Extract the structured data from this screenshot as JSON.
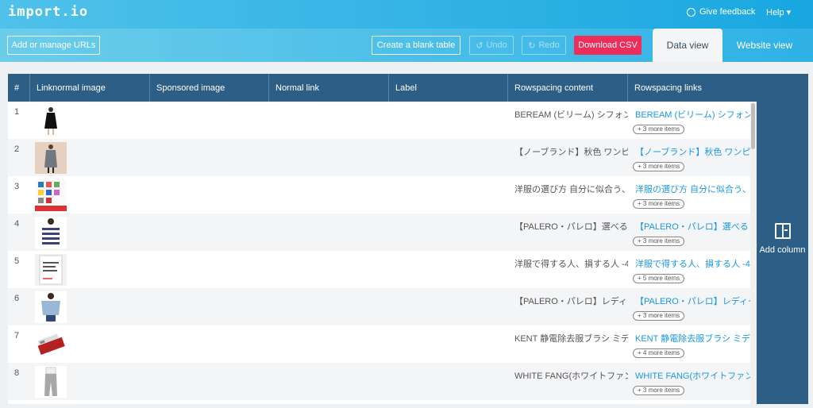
{
  "app": {
    "logo": "import.io",
    "feedback": "Give feedback",
    "help": "Help ▾"
  },
  "toolbar": {
    "add_urls": "Add or manage URLs",
    "blank_table": "Create a blank table",
    "undo": "Undo",
    "redo": "Redo",
    "download": "Download CSV",
    "tab_data": "Data view",
    "tab_website": "Website view"
  },
  "columns": [
    "#",
    "Linknormal image",
    "Sponsored image",
    "Normal link",
    "Label",
    "Rowspacing content",
    "Rowspacing links"
  ],
  "rows": [
    {
      "num": "1",
      "thumb": "dress-black",
      "content": "BEREAM (ビリーム) シフォン...",
      "link": "BEREAM (ビリーム) シフォン...",
      "more": "+ 3 more items"
    },
    {
      "num": "2",
      "thumb": "dress-grey",
      "content": "【ノーブランド】秋色 ワンピ...",
      "link": "【ノーブランド】秋色 ワンピ...",
      "more": "+ 3 more items"
    },
    {
      "num": "3",
      "thumb": "book-clothes",
      "content": "洋服の選び方 自分に似合う、...",
      "link": "洋服の選び方 自分に似合う、...",
      "more": "+ 3 more items"
    },
    {
      "num": "4",
      "thumb": "striped-top",
      "content": "【PALERO・パレロ】選べる６...",
      "link": "【PALERO・パレロ】選べる６...",
      "more": "+ 3 more items"
    },
    {
      "num": "5",
      "thumb": "book-white",
      "content": "洋服で得する人、損する人 -4...",
      "link": "洋服で得する人、損する人 -4...",
      "more": "+ 5 more items"
    },
    {
      "num": "6",
      "thumb": "blouse-blue",
      "content": "【PALERO・パレロ】レディー...",
      "link": "【PALERO・パレロ】レディー...",
      "more": "+ 3 more items"
    },
    {
      "num": "7",
      "thumb": "lint-brush",
      "content": "KENT 静電除去服ブラシ ミデ...",
      "link": "KENT 静電除去服ブラシ ミデ...",
      "more": "+ 4 more items"
    },
    {
      "num": "8",
      "thumb": "pants-grey",
      "content": "WHITE FANG(ホワイトファン...",
      "link": "WHITE FANG(ホワイトファン...",
      "more": "+ 3 more items"
    }
  ],
  "add_column": "Add column",
  "colors": {
    "header": "#2d5e86",
    "accent": "#1a97e2",
    "download": "#ee2d5b"
  }
}
